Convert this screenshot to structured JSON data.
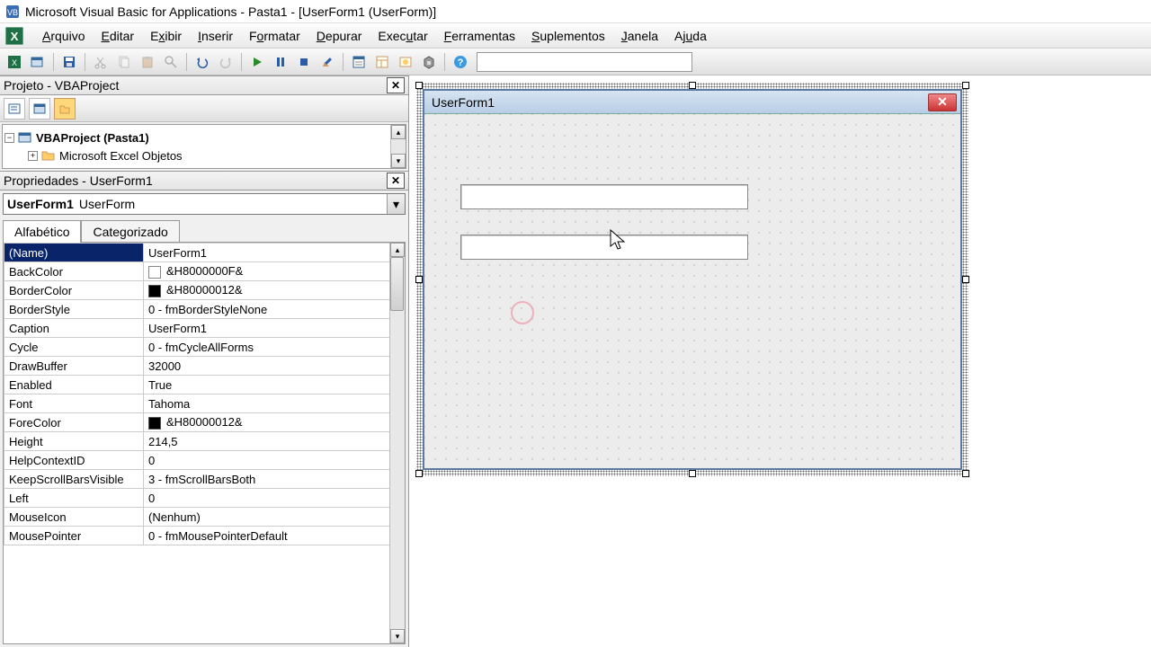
{
  "title": "Microsoft Visual Basic for Applications - Pasta1 - [UserForm1 (UserForm)]",
  "menu": {
    "arquivo": "Arquivo",
    "editar": "Editar",
    "exibir": "Exibir",
    "inserir": "Inserir",
    "formatar": "Formatar",
    "depurar": "Depurar",
    "executar": "Executar",
    "ferramentas": "Ferramentas",
    "suplementos": "Suplementos",
    "janela": "Janela",
    "ajuda": "Ajuda"
  },
  "project_panel": {
    "title": "Projeto - VBAProject",
    "root": "VBAProject (Pasta1)",
    "child1": "Microsoft Excel Objetos"
  },
  "props_panel": {
    "title": "Propriedades - UserForm1",
    "object_bold": "UserForm1",
    "object_type": "UserForm",
    "tab_alpha": "Alfabético",
    "tab_cat": "Categorizado",
    "rows": [
      {
        "k": "(Name)",
        "v": "UserForm1",
        "sel": true
      },
      {
        "k": "BackColor",
        "v": "&H8000000F&",
        "sw": "#ffffff",
        "swborder": "#888"
      },
      {
        "k": "BorderColor",
        "v": "&H80000012&",
        "sw": "#000000"
      },
      {
        "k": "BorderStyle",
        "v": "0 - fmBorderStyleNone"
      },
      {
        "k": "Caption",
        "v": "UserForm1"
      },
      {
        "k": "Cycle",
        "v": "0 - fmCycleAllForms"
      },
      {
        "k": "DrawBuffer",
        "v": "32000"
      },
      {
        "k": "Enabled",
        "v": "True"
      },
      {
        "k": "Font",
        "v": "Tahoma"
      },
      {
        "k": "ForeColor",
        "v": "&H80000012&",
        "sw": "#000000"
      },
      {
        "k": "Height",
        "v": "214,5"
      },
      {
        "k": "HelpContextID",
        "v": "0"
      },
      {
        "k": "KeepScrollBarsVisible",
        "v": "3 - fmScrollBarsBoth"
      },
      {
        "k": "Left",
        "v": "0"
      },
      {
        "k": "MouseIcon",
        "v": "(Nenhum)"
      },
      {
        "k": "MousePointer",
        "v": "0 - fmMousePointerDefault"
      }
    ]
  },
  "form": {
    "caption": "UserForm1"
  }
}
